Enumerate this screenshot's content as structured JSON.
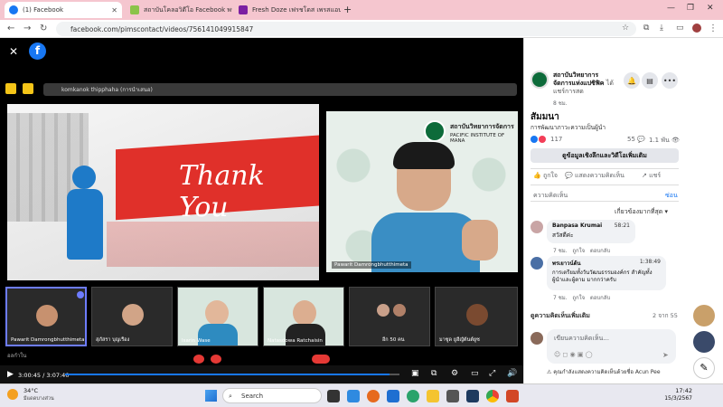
{
  "browser": {
    "tabs": [
      {
        "title": "(1) Facebook",
        "active": true
      },
      {
        "title": "สถาบันโคลอวิดีโอ Facebook พร้อมกับ",
        "active": false
      },
      {
        "title": "Fresh Doze เฟรชโดส เพรสแอนด์เชค",
        "active": false
      }
    ],
    "url": "facebook.com/pimscontact/videos/756141049915847"
  },
  "zoom": {
    "presenter_bar": "komkanok thipphaha (การนำเสนอ)",
    "slide_text": "Thank You",
    "speaker_banner": "สถาบันวิทยาการจัดการ",
    "speaker_banner_en": "PACIFIC INSTITUTE OF MANA",
    "speaker_name": "Pawarit Damrongbhutthimeta",
    "participants": [
      {
        "name": "Pawarit Damrongbhutthimeta"
      },
      {
        "name": "สุภัสรา บุญเรือง"
      },
      {
        "name": "Isarin Wase"
      },
      {
        "name": "Natasdowa Ratchaisin"
      },
      {
        "name": "อีก 50 คน"
      },
      {
        "name": "มาซูด ยูฮีญัต้นต์ยูซ"
      }
    ],
    "participant_extra": "อลกำใน",
    "time_current": "3:00:45",
    "time_total": "3:07:40",
    "progress_fraction": 0.97
  },
  "right": {
    "page_name": "สถาบันวิทยาการจัดการแห่งแปซิฟิค",
    "page_sub": "ได้แชร์การสด",
    "posted": "8 ชม.",
    "post_title": "สัมมนา",
    "post_desc": "การพัฒนาภาวะความเป็นผู้นำ",
    "reactions": "117",
    "comments_count": "55",
    "views": "1.1 พัน",
    "more_info_button": "ดูข้อมูลเชิงลึกและวิดีโอเพิ่มเติม",
    "actions": [
      "ถูกใจ",
      "แสดงความคิดเห็น",
      "แชร์"
    ],
    "comments_label": "ความคิดเห็น",
    "hide_label": "ซ่อน",
    "sort_label": "เกี่ยวข้องมากที่สุด",
    "comments": [
      {
        "author": "Banpasa Krumai",
        "time": "58:21",
        "text": "สวัสดีค่ะ",
        "ago": "7 ชม.",
        "like": "ถูกใจ",
        "reply": "ตอบกลับ"
      },
      {
        "author": "พรเยาวน์ต้น",
        "time": "1:38:49",
        "text": "การเตรียมทั้งวันวัฒนธรรมองค์กร สำคัญทั้งผู้นำและผู้ตาม มากกว่าครับ",
        "ago": "7 ชม.",
        "like": "ถูกใจ",
        "reply": "ตอบกลับ"
      }
    ],
    "more_comments": "ดูความคิดเห็นเพิ่มเติม",
    "more_count": "2 จาก 55",
    "write_placeholder": "เขียนความคิดเห็น...",
    "warning": "คุณกำลังแสดงความคิดเห็นด้วยชื่อ Acun Pee",
    "notif_badge": "1"
  },
  "taskbar": {
    "weather": "34°C",
    "weather_sub": "มีแดดบางส่วน",
    "search": "Search",
    "time": "17:42",
    "date": "15/3/2567"
  },
  "colors": {
    "fb_blue": "#1877f2",
    "tab_bg": "#f5c6cf",
    "slide_red": "#e0302a"
  }
}
